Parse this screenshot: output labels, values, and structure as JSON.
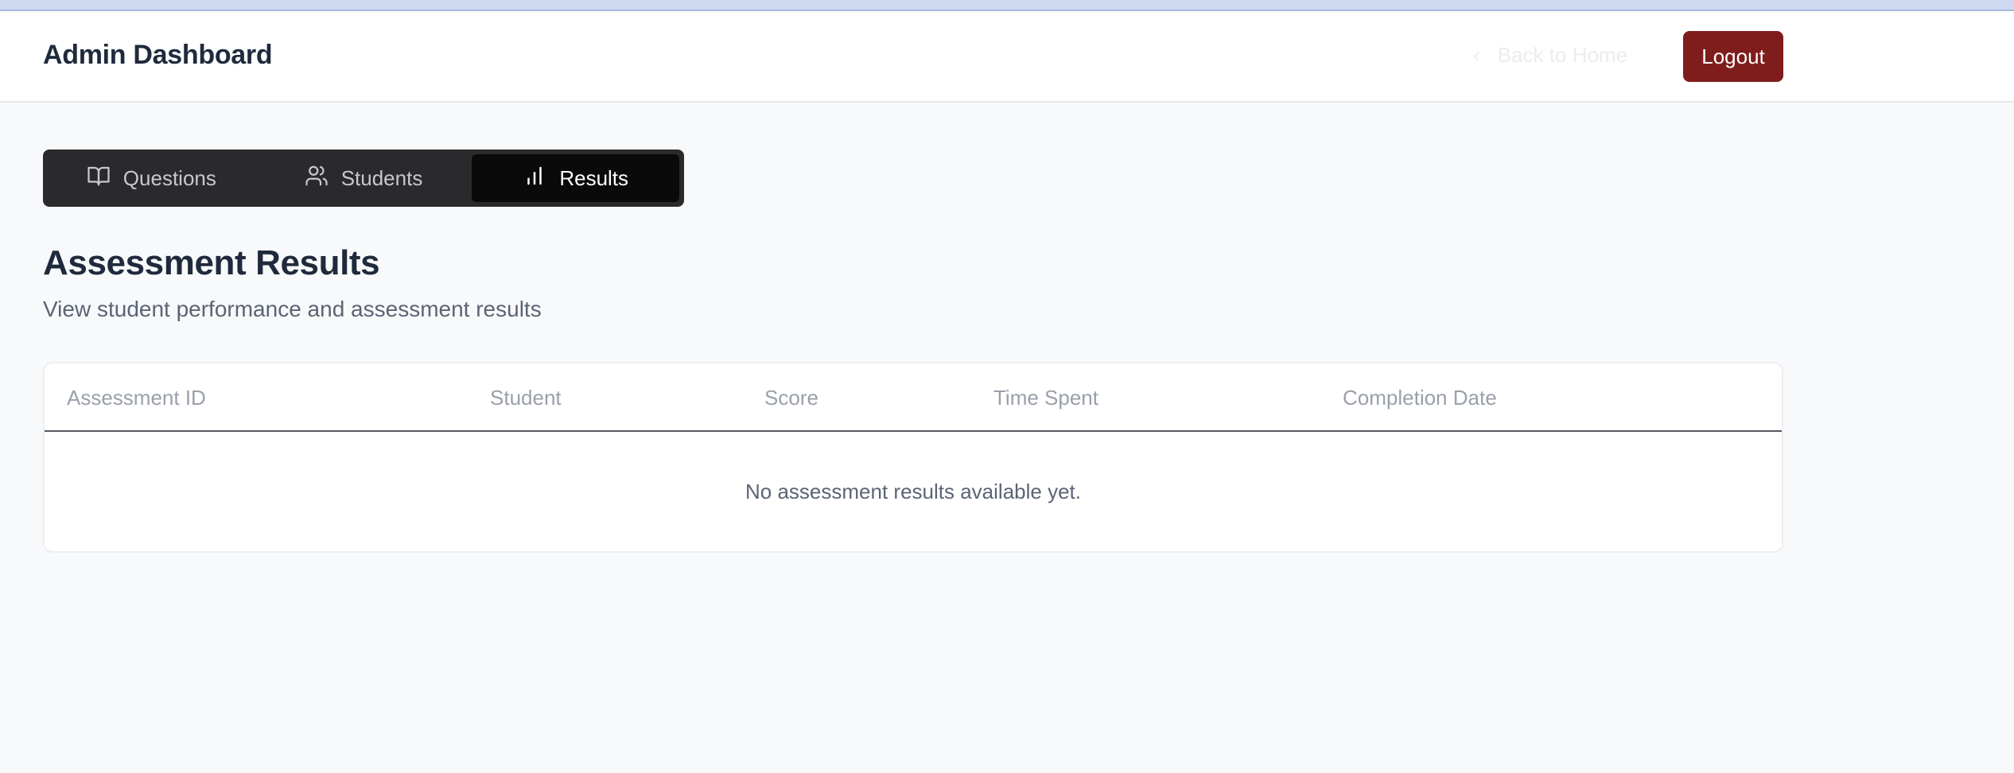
{
  "header": {
    "title": "Admin Dashboard",
    "back_label": "Back to Home",
    "back_chevron": "‹",
    "logout_label": "Logout"
  },
  "tabs": [
    {
      "label": "Questions",
      "icon": "book-open-icon",
      "active": false
    },
    {
      "label": "Students",
      "icon": "users-icon",
      "active": false
    },
    {
      "label": "Results",
      "icon": "bar-chart-icon",
      "active": true
    }
  ],
  "main": {
    "title": "Assessment Results",
    "subtitle": "View student performance and assessment results"
  },
  "table": {
    "columns": [
      "Assessment ID",
      "Student",
      "Score",
      "Time Spent",
      "Completion Date"
    ],
    "empty_message": "No assessment results available yet."
  },
  "colors": {
    "logout_bg": "#7f1d1d",
    "tabs_bg": "#2a2a2c",
    "tab_active_bg": "#0a0a0b",
    "page_bg": "#f8f9fb"
  }
}
